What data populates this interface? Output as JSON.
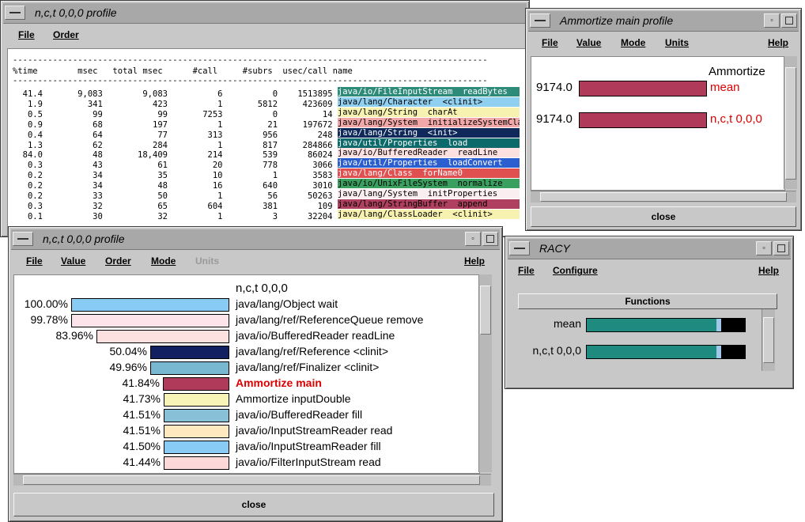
{
  "win1": {
    "title": "n,c,t 0,0,0 profile",
    "menus": [
      "File",
      "Order"
    ],
    "header": "%time        msec   total msec      #call     #subrs  usec/call name",
    "rows": [
      {
        "cols": "  41.4       9,083        9,083          6          0    1513895 ",
        "name": "java/io/FileInputStream  readBytes",
        "color": "#2e8b7a",
        "fg": "#ffffff"
      },
      {
        "cols": "   1.9         341          423          1       5812     423609 ",
        "name": "java/lang/Character  <clinit>",
        "color": "#8fd0f0",
        "fg": "#000000"
      },
      {
        "cols": "   0.5          99           99       7253          0         14 ",
        "name": "java/lang/String  charAt",
        "color": "#f7f2b0",
        "fg": "#000000"
      },
      {
        "cols": "   0.9          68          197          1         21     197672 ",
        "name": "java/lang/System  initializeSystemClass",
        "color": "#f2a8a8",
        "fg": "#000000"
      },
      {
        "cols": "   0.4          64           77        313        956        248 ",
        "name": "java/lang/String  <init>",
        "color": "#0f2a5a",
        "fg": "#ffffff"
      },
      {
        "cols": "   1.3          62          284          1        817     284866 ",
        "name": "java/util/Properties  load",
        "color": "#0c6a6a",
        "fg": "#ffffff"
      },
      {
        "cols": "  84.0          48       18,409        214        539      86024 ",
        "name": "java/io/BufferedReader  readLine",
        "color": "#fde0e0",
        "fg": "#000000"
      },
      {
        "cols": "   0.3          43           61         20        778       3066 ",
        "name": "java/util/Properties  loadConvert",
        "color": "#2b5fd0",
        "fg": "#ffffff"
      },
      {
        "cols": "   0.2          34           35         10          1       3583 ",
        "name": "java/lang/Class  forName0",
        "color": "#e05050",
        "fg": "#ffffff"
      },
      {
        "cols": "   0.2          34           48         16        640       3010 ",
        "name": "java/io/UnixFileSystem  normalize",
        "color": "#3aa060",
        "fg": "#000000"
      },
      {
        "cols": "   0.2          33           50          1         56      50263 ",
        "name": "java/lang/System  initProperties",
        "color": "#fbeef0",
        "fg": "#000000"
      },
      {
        "cols": "   0.3          32           65        604        381        109 ",
        "name": "java/lang/StringBuffer  append",
        "color": "#b04060",
        "fg": "#000000"
      },
      {
        "cols": "   0.1          30           32          1          3      32204 ",
        "name": "java/lang/ClassLoader  <clinit>",
        "color": "#f7f2b0",
        "fg": "#000000"
      }
    ]
  },
  "win2": {
    "title": "Ammortize  main  profile",
    "menus": [
      "File",
      "Value",
      "Mode",
      "Units",
      "Help"
    ],
    "heading": "Ammortize",
    "rows": [
      {
        "value": "9174.0",
        "label": "mean",
        "fill": 1.0
      },
      {
        "value": "9174.0",
        "label": "n,c,t 0,0,0",
        "fill": 1.0
      }
    ],
    "bar_color": "#b03a5a",
    "close": "close"
  },
  "win3": {
    "title": "n,c,t 0,0,0 profile",
    "menus": [
      "File",
      "Value",
      "Order",
      "Mode",
      "Units",
      "Help"
    ],
    "heading": "n,c,t 0,0,0",
    "rows": [
      {
        "pct": "100.00%",
        "name": "java/lang/Object  wait",
        "color": "#88ccf5",
        "highlight": false
      },
      {
        "pct": "99.78%",
        "name": "java/lang/ref/ReferenceQueue  remove",
        "color": "#fde4ea",
        "highlight": false
      },
      {
        "pct": "83.96%",
        "name": "java/io/BufferedReader  readLine",
        "color": "#fde0e0",
        "highlight": false
      },
      {
        "pct": "50.04%",
        "name": "java/lang/ref/Reference  <clinit>",
        "color": "#102060",
        "highlight": false
      },
      {
        "pct": "49.96%",
        "name": "java/lang/ref/Finalizer  <clinit>",
        "color": "#78b8d0",
        "highlight": false
      },
      {
        "pct": "41.84%",
        "name": "Ammortize  main",
        "color": "#b03a5a",
        "highlight": true
      },
      {
        "pct": "41.73%",
        "name": "Ammortize  inputDouble",
        "color": "#f8f4b8",
        "highlight": false
      },
      {
        "pct": "41.51%",
        "name": "java/io/BufferedReader  fill",
        "color": "#88c0d8",
        "highlight": false
      },
      {
        "pct": "41.51%",
        "name": "java/io/InputStreamReader  read",
        "color": "#fde8c0",
        "highlight": false
      },
      {
        "pct": "41.50%",
        "name": "java/io/InputStreamReader  fill",
        "color": "#88ccf5",
        "highlight": false
      },
      {
        "pct": "41.44%",
        "name": "java/io/FilterInputStream  read",
        "color": "#fdd8d8",
        "highlight": false
      }
    ],
    "close": "close"
  },
  "win4": {
    "title": "RACY",
    "menus": [
      "File",
      "Configure",
      "Help"
    ],
    "functions_button": "Functions",
    "rows": [
      {
        "label": "mean",
        "fill": 0.82
      },
      {
        "label": "n,c,t 0,0,0",
        "fill": 0.82
      }
    ],
    "bar_color": "#1e8a80"
  }
}
